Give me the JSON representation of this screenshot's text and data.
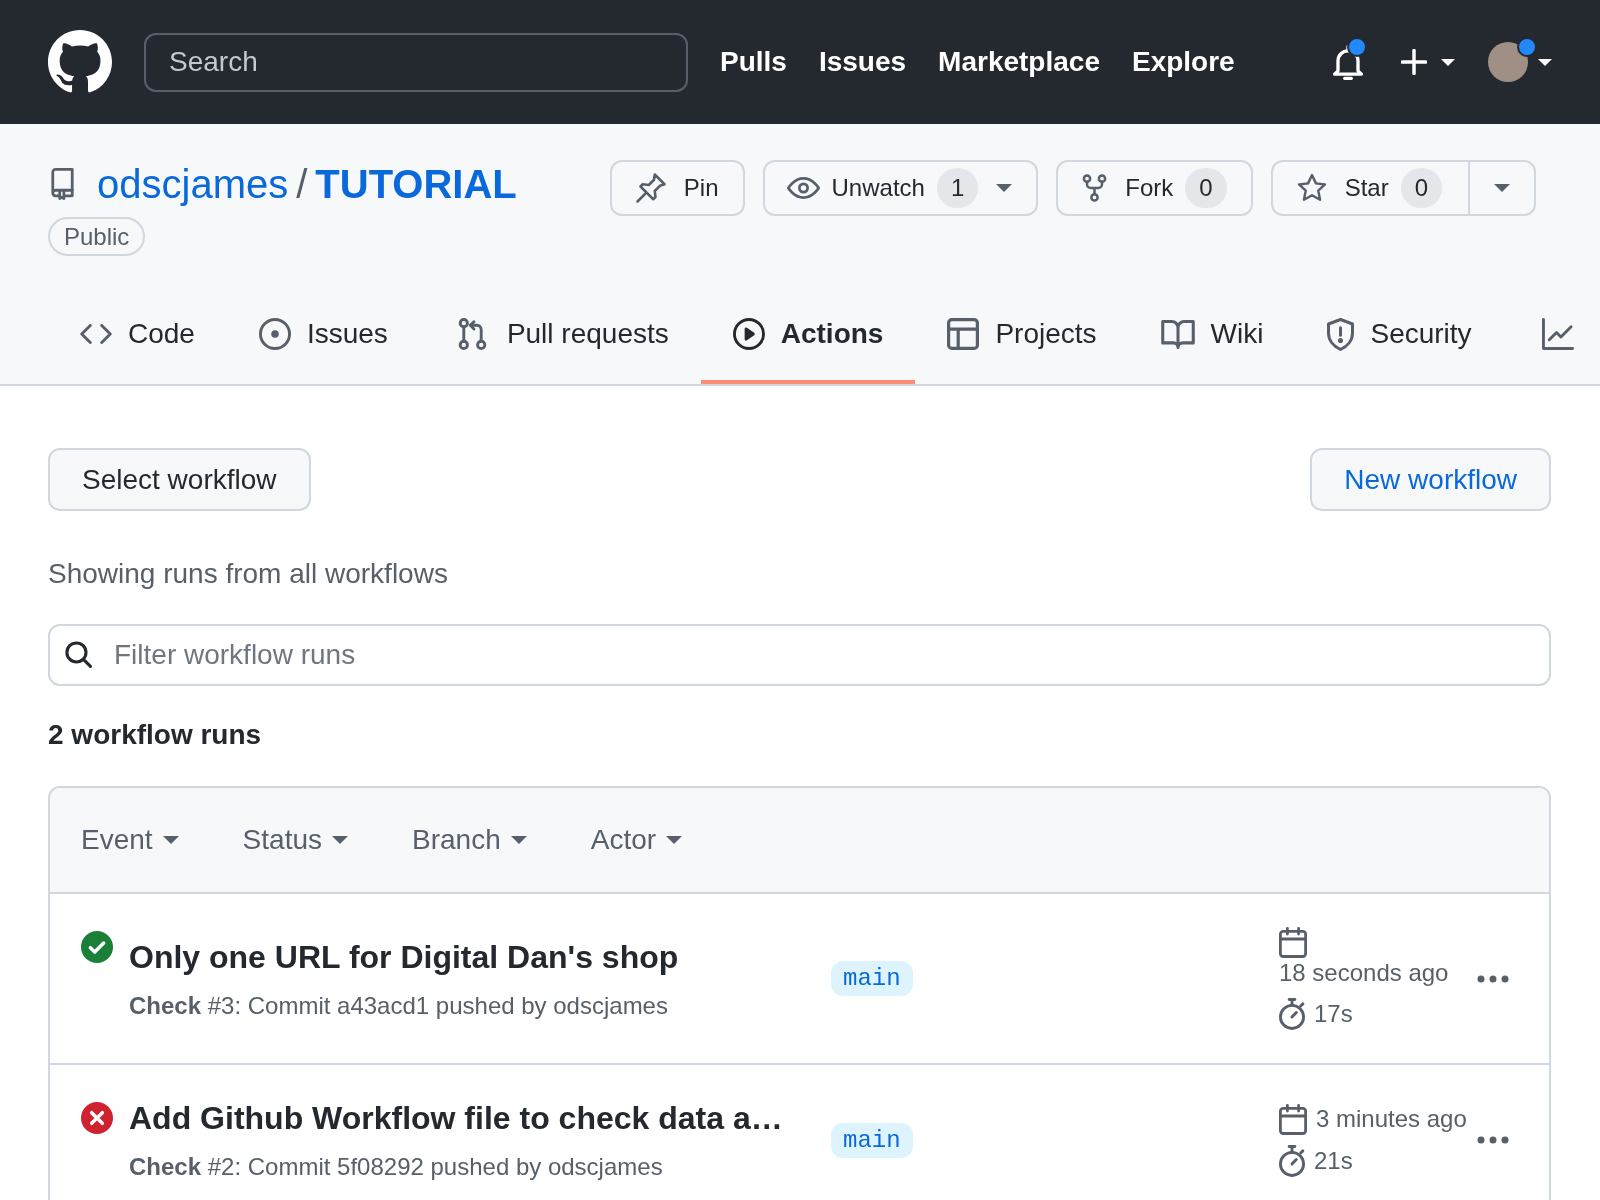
{
  "header": {
    "search": {
      "placeholder": "Search"
    },
    "nav": [
      "Pulls",
      "Issues",
      "Marketplace",
      "Explore"
    ],
    "notifications": {
      "unread": true
    },
    "account": {
      "unread": true
    }
  },
  "repo": {
    "owner": "odscjames",
    "separator": "/",
    "name": "TUTORIAL",
    "visibility": "Public",
    "buttons": [
      {
        "kind": "pin",
        "label": "Pin",
        "dropdown": false,
        "split_menu": false
      },
      {
        "kind": "watch",
        "label": "Unwatch",
        "count": "1",
        "dropdown": true,
        "split_menu": false
      },
      {
        "kind": "fork",
        "label": "Fork",
        "count": "0",
        "dropdown": false,
        "split_menu": false
      },
      {
        "kind": "star",
        "label": "Star",
        "count": "0",
        "dropdown": false,
        "split_menu": true
      }
    ],
    "tabs": [
      {
        "kind": "code",
        "label": "Code",
        "selected": false
      },
      {
        "kind": "issues",
        "label": "Issues",
        "selected": false
      },
      {
        "kind": "pulls",
        "label": "Pull requests",
        "selected": false
      },
      {
        "kind": "actions",
        "label": "Actions",
        "selected": true
      },
      {
        "kind": "projects",
        "label": "Projects",
        "selected": false
      },
      {
        "kind": "wiki",
        "label": "Wiki",
        "selected": false
      },
      {
        "kind": "security",
        "label": "Security",
        "selected": false
      },
      {
        "kind": "graph",
        "selected": false
      }
    ]
  },
  "actions": {
    "select_workflow": "Select workflow",
    "new_workflow": "New workflow",
    "caption": "Showing runs from all workflows",
    "filter": {
      "placeholder": "Filter workflow runs"
    },
    "count": "2 workflow runs",
    "filters": [
      "Event",
      "Status",
      "Branch",
      "Actor"
    ],
    "runs": [
      {
        "passed": true,
        "title": "Only one URL for Digital Dan's shop",
        "detail": "**Check** #3: Commit a43acd1 pushed by odscjames",
        "branch": "main",
        "time": "18 seconds ago",
        "duration": "17s"
      },
      {
        "passed": false,
        "title": "Add Github Workflow file to check data a…",
        "detail": "**Check** #2: Commit 5f08292 pushed by odscjames",
        "branch": "main",
        "time": "3 minutes ago",
        "duration": "21s"
      }
    ]
  }
}
